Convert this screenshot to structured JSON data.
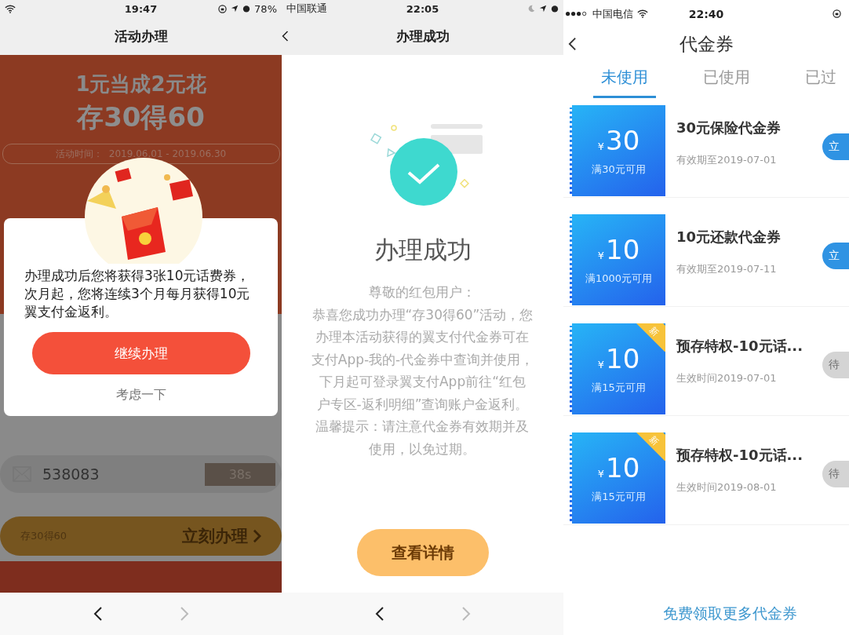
{
  "activity_screen": {
    "status_bar": {
      "time": "19:47",
      "battery": "78%"
    },
    "title": "活动办理",
    "hero": {
      "headline": "1元当成2元花",
      "offer": "存30得60",
      "period_label": "活动时间：",
      "period": "2019.06.01 - 2019.06.30"
    },
    "dialog": {
      "message": "办理成功后您将获得3张10元话费券，次月起，您将连续3个月每月获得10元翼支付金返利。",
      "confirm_button": "继续办理",
      "cancel_link": "考虑一下"
    },
    "code_field": {
      "value": "538083",
      "countdown": "38s"
    },
    "action_bar": {
      "label": "存30得60",
      "button": "立刻办理"
    },
    "browser_nav": {
      "back": {
        "disabled": false
      },
      "forward": {
        "disabled": true
      }
    }
  },
  "success_screen": {
    "status_bar": {
      "carrier": "中国联通",
      "time": "22:05"
    },
    "title": "办理成功",
    "heading": "办理成功",
    "message_lines": [
      "尊敬的红包用户：",
      "恭喜您成功办理“存30得60”活动，您",
      "办理本活动获得的翼支付代金券可在",
      "支付App-我的-代金券中查询并使用，",
      "下月起可登录翼支付App前往“红包",
      "户专区-返利明细”查询账户金返利。",
      "温馨提示：请注意代金券有效期并及",
      "使用，以免过期。"
    ],
    "button": "查看详情",
    "browser_nav": {
      "back": {
        "disabled": false
      },
      "forward": {
        "disabled": true
      }
    }
  },
  "voucher_screen": {
    "status_bar": {
      "carrier": "中国电信",
      "time": "22:40"
    },
    "title": "代金券",
    "tabs": [
      {
        "label": "未使用",
        "selected": true
      },
      {
        "label": "已使用",
        "selected": false
      },
      {
        "label": "已过",
        "selected": false
      }
    ],
    "vouchers": [
      {
        "currency": "¥",
        "amount": "30",
        "condition": "满30元可用",
        "name": "30元保险代金券",
        "validity": "有效期至2019-07-01",
        "action": "立",
        "disabled": false
      },
      {
        "currency": "¥",
        "amount": "10",
        "condition": "满1000元可用",
        "name": "10元还款代金券",
        "validity": "有效期至2019-07-11",
        "action": "立",
        "disabled": false
      },
      {
        "currency": "¥",
        "amount": "10",
        "condition": "满15元可用",
        "badge": "新",
        "name": "预存特权-10元话...",
        "validity": "生效时间2019-07-01",
        "action": "待",
        "disabled": true
      },
      {
        "currency": "¥",
        "amount": "10",
        "condition": "满15元可用",
        "badge": "新",
        "name": "预存特权-10元话...",
        "validity": "生效时间2019-08-01",
        "action": "待",
        "disabled": true
      }
    ],
    "footer_link": "免费领取更多代金券"
  }
}
